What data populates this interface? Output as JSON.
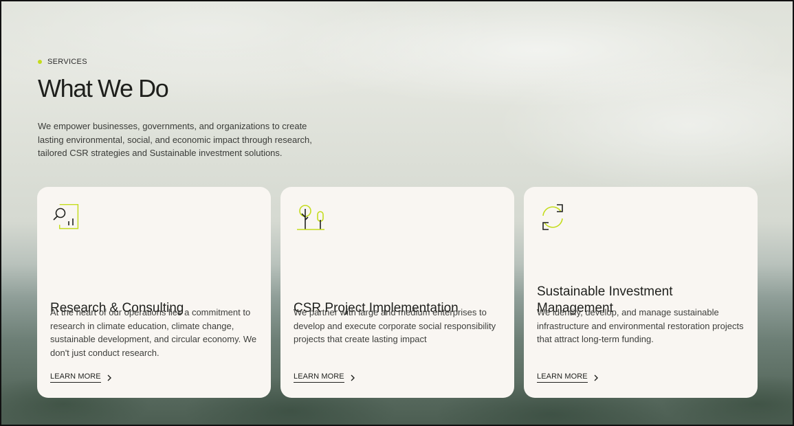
{
  "section": {
    "eyebrow": "SERVICES",
    "title": "What We Do",
    "intro": "We empower businesses, governments, and organizations to create lasting environmental, social, and economic impact through research, tailored CSR strategies and Sustainable investment solutions."
  },
  "cards": [
    {
      "icon": "research-chart-icon",
      "title": "Research & Consulting",
      "description": "At the heart of our operations lies a commitment to research in climate education, climate change, sustainable development, and circular economy. We don't just conduct research.",
      "link": "LEARN MORE"
    },
    {
      "icon": "trees-icon",
      "title": "CSR Project Implementation",
      "description": "We partner with large and medium enterprises to develop and execute corporate social responsibility projects that create lasting impact",
      "link": "LEARN MORE"
    },
    {
      "icon": "refresh-arrows-icon",
      "title": "Sustainable Investment Management",
      "description": "We identify, develop, and manage sustainable infrastructure and environmental restoration projects that attract long-term funding.",
      "link": "LEARN MORE"
    }
  ],
  "colors": {
    "accent": "#c4dc1c",
    "card_bg": "#f9f6f2",
    "text": "#1f201d"
  }
}
